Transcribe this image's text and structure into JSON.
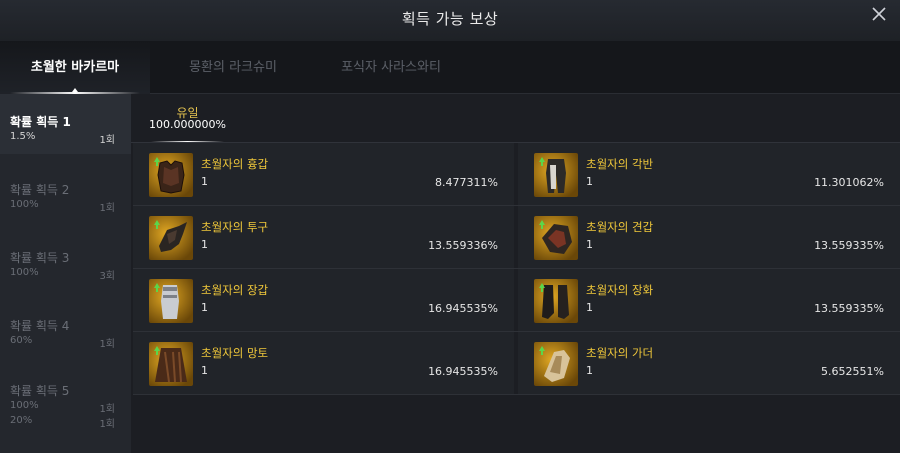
{
  "window": {
    "title": "획득 가능 보상",
    "close_icon": "close-icon"
  },
  "tabs": [
    {
      "label": "초월한 바카르마",
      "active": true
    },
    {
      "label": "몽환의 라크슈미",
      "active": false
    },
    {
      "label": "포식자 사라스와티",
      "active": false
    }
  ],
  "sidebar": {
    "items": [
      {
        "label": "확률 획득 1",
        "rows": [
          {
            "pct": "1.5%",
            "count": "1회"
          }
        ],
        "active": true
      },
      {
        "label": "확률 획득 2",
        "rows": [
          {
            "pct": "100%",
            "count": "1회"
          }
        ],
        "active": false
      },
      {
        "label": "확률 획득 3",
        "rows": [
          {
            "pct": "100%",
            "count": "3회"
          }
        ],
        "active": false
      },
      {
        "label": "확률 획득 4",
        "rows": [
          {
            "pct": "60%",
            "count": "1회"
          }
        ],
        "active": false
      },
      {
        "label": "확률 획득 5",
        "rows": [
          {
            "pct": "100%",
            "count": "1회"
          },
          {
            "pct": "20%",
            "count": "1회"
          }
        ],
        "active": false
      }
    ]
  },
  "grade_tab": {
    "grade": "유일",
    "probability": "100.000000%",
    "grade_color": "#e3c24f"
  },
  "rewards": [
    {
      "name": "초월자의 흉갑",
      "qty": "1",
      "pct": "8.477311%",
      "icon": "chest-armor-icon"
    },
    {
      "name": "초월자의 각반",
      "qty": "1",
      "pct": "11.301062%",
      "icon": "leg-armor-icon"
    },
    {
      "name": "초월자의 투구",
      "qty": "1",
      "pct": "13.559336%",
      "icon": "helmet-icon"
    },
    {
      "name": "초월자의 견갑",
      "qty": "1",
      "pct": "13.559335%",
      "icon": "pauldron-icon"
    },
    {
      "name": "초월자의 장갑",
      "qty": "1",
      "pct": "16.945535%",
      "icon": "gauntlet-icon"
    },
    {
      "name": "초월자의 장화",
      "qty": "1",
      "pct": "13.559335%",
      "icon": "boots-icon"
    },
    {
      "name": "초월자의 망토",
      "qty": "1",
      "pct": "16.945535%",
      "icon": "cloak-icon"
    },
    {
      "name": "초월자의 가더",
      "qty": "1",
      "pct": "5.652551%",
      "icon": "guarder-icon"
    }
  ],
  "colors": {
    "item_name": "#f0c83a",
    "upgrade_arrow": "#5cd64a",
    "icon_bg": "#c9920f"
  }
}
